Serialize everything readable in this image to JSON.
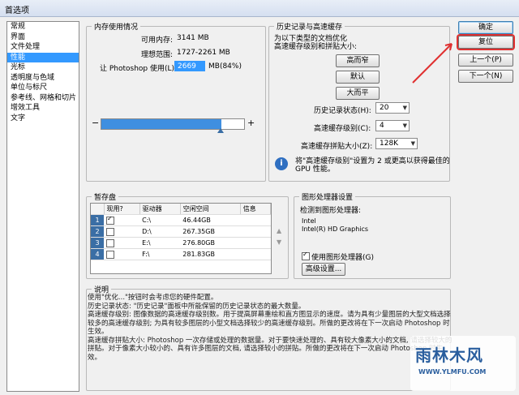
{
  "window": {
    "title": "首选项"
  },
  "sidebar": {
    "items": [
      "常规",
      "界面",
      "文件处理",
      "性能",
      "光标",
      "透明度与色域",
      "单位与标尺",
      "参考线、网格和切片",
      "增效工具",
      "文字"
    ],
    "selected_index": 3
  },
  "memory": {
    "legend": "内存使用情况",
    "available_label": "可用内存:",
    "available_value": "3141 MB",
    "ideal_label": "理想范围:",
    "ideal_value": "1727-2261 MB",
    "let_label": "让 Photoshop 使用(L):",
    "let_value": "2669",
    "let_suffix": "MB(84%)",
    "minus": "−",
    "plus": "+",
    "slider_fraction": 0.84
  },
  "history": {
    "legend": "历史记录与高速缓存",
    "hint": [
      "为以下类型的文档优化",
      "高速缓存级别和拼贴大小:"
    ],
    "btn_tall": "高而窄",
    "btn_default": "默认",
    "btn_big": "大而平",
    "states_label": "历史记录状态(H):",
    "states_value": "20",
    "levels_label": "高速缓存级别(C):",
    "levels_value": "4",
    "tile_label": "高速缓存拼贴大小(Z):",
    "tile_value": "128K",
    "info_text": [
      "将\"高速缓存级别\"设置为 2 或更高以获得最佳的",
      "GPU 性能。"
    ],
    "info_icon": "i"
  },
  "buttons": {
    "ok": "确定",
    "reset": "复位",
    "prev": "上一个(P)",
    "next": "下一个(N)"
  },
  "scratch": {
    "legend": "暂存盘",
    "headers": [
      "",
      "现用?",
      "驱动器",
      "空闲空间",
      "信息"
    ],
    "rows": [
      {
        "n": "1",
        "drive": "C:\\",
        "free": "46.44GB",
        "info": ""
      },
      {
        "n": "2",
        "drive": "D:\\",
        "free": "267.35GB",
        "info": ""
      },
      {
        "n": "3",
        "drive": "E:\\",
        "free": "276.80GB",
        "info": ""
      },
      {
        "n": "4",
        "drive": "F:\\",
        "free": "281.83GB",
        "info": ""
      }
    ],
    "up_icon": "▲",
    "down_icon": "▼"
  },
  "gpu": {
    "legend": "图形处理器设置",
    "detected_label": "检测到图形处理器:",
    "gpu_name": [
      "Intel",
      "Intel(R) HD Graphics"
    ],
    "use_label": "使用图形处理器(G)",
    "advanced": "高级设置..."
  },
  "description": {
    "legend": "说明",
    "lines": [
      "使用\"优化...\"按钮时会考虑您的硬件配置。",
      "历史记录状态: \"历史记录\"面板中所能保留的历史记录状态的最大数量。",
      "高速缓存级别: 图像数据的高速缓存级别数。用于提高屏幕重绘和直方图显示的速度。请为具有少量图层的大型文档选择较多的高速缓存级别; 为具有较多图层的小型文档选择较少的高速缓存级别。所做的更改将在下一次启动 Photoshop 时生效。",
      "高速缓存拼贴大小: Photoshop 一次存储或处理的数据量。对于要快速处理的、具有较大像素大小的文档, 请选择较大的拼贴。对于像素大小较小的、具有许多图层的文档, 请选择较小的拼贴。所做的更改将在下一次启动 Photoshop 时生效。"
    ]
  },
  "watermark": {
    "brand": "雨林木风",
    "url": "WWW.YLMFU.COM"
  }
}
